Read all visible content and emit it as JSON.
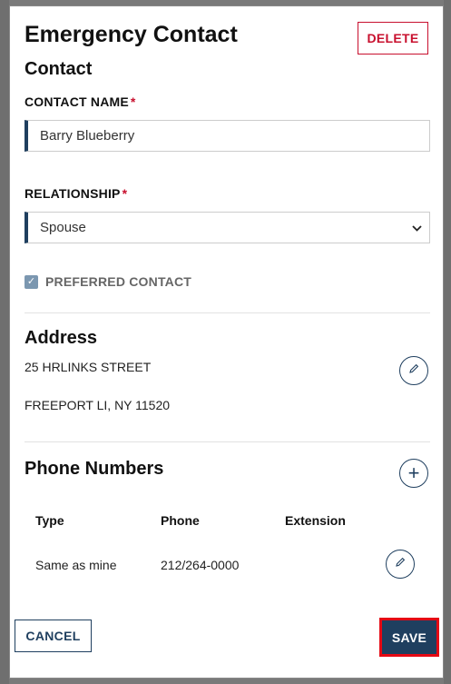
{
  "modal": {
    "title": "Emergency Contact",
    "delete_label": "DELETE",
    "subtitle": "Contact"
  },
  "contact_name": {
    "label": "CONTACT NAME",
    "required_mark": "*",
    "value": "Barry Blueberry"
  },
  "relationship": {
    "label": "RELATIONSHIP",
    "required_mark": "*",
    "selected": "Spouse"
  },
  "preferred": {
    "label": "PREFERRED CONTACT",
    "checked": true,
    "check_glyph": "✓"
  },
  "address": {
    "title": "Address",
    "line1": "25 HRLINKS STREET",
    "line2": "FREEPORT LI, NY 11520"
  },
  "phones": {
    "title": "Phone Numbers",
    "add_glyph": "+",
    "columns": [
      "Type",
      "Phone",
      "Extension"
    ],
    "rows": [
      {
        "type": "Same as mine",
        "phone": "212/264-0000",
        "extension": ""
      }
    ]
  },
  "footer": {
    "cancel_label": "CANCEL",
    "save_label": "SAVE"
  },
  "colors": {
    "accent": "#1f3f5f",
    "danger": "#c8102e",
    "highlight": "#e50914"
  }
}
